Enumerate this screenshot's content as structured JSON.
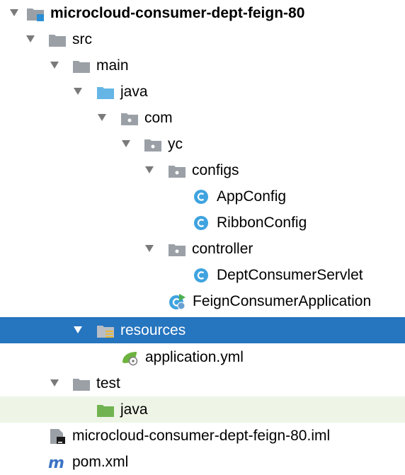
{
  "tree": {
    "items": [
      {
        "label": "microcloud-consumer-dept-feign-80",
        "kind": "module",
        "expanded": true
      },
      {
        "label": "src",
        "kind": "folder",
        "expanded": true
      },
      {
        "label": "main",
        "kind": "folder",
        "expanded": true
      },
      {
        "label": "java",
        "kind": "source-root",
        "expanded": true
      },
      {
        "label": "com",
        "kind": "package",
        "expanded": true
      },
      {
        "label": "yc",
        "kind": "package",
        "expanded": true
      },
      {
        "label": "configs",
        "kind": "package",
        "expanded": true
      },
      {
        "label": "AppConfig",
        "kind": "class"
      },
      {
        "label": "RibbonConfig",
        "kind": "class"
      },
      {
        "label": "controller",
        "kind": "package",
        "expanded": true
      },
      {
        "label": "DeptConsumerServlet",
        "kind": "class"
      },
      {
        "label": "FeignConsumerApplication",
        "kind": "spring-boot-class"
      },
      {
        "label": "resources",
        "kind": "resources-root",
        "expanded": true,
        "selected": true
      },
      {
        "label": "application.yml",
        "kind": "spring-config-file"
      },
      {
        "label": "test",
        "kind": "folder",
        "expanded": true
      },
      {
        "label": "java",
        "kind": "test-root"
      },
      {
        "label": "microcloud-consumer-dept-feign-80.iml",
        "kind": "iml-file"
      },
      {
        "label": "pom.xml",
        "kind": "maven-file"
      }
    ]
  },
  "colors": {
    "selection": "#2675bf",
    "test_root_highlight": "#eef5e6",
    "class_icon": "#3fa3df",
    "source_folder": "#65b6e6",
    "test_folder": "#72b351",
    "folder": "#9aa0a6"
  }
}
